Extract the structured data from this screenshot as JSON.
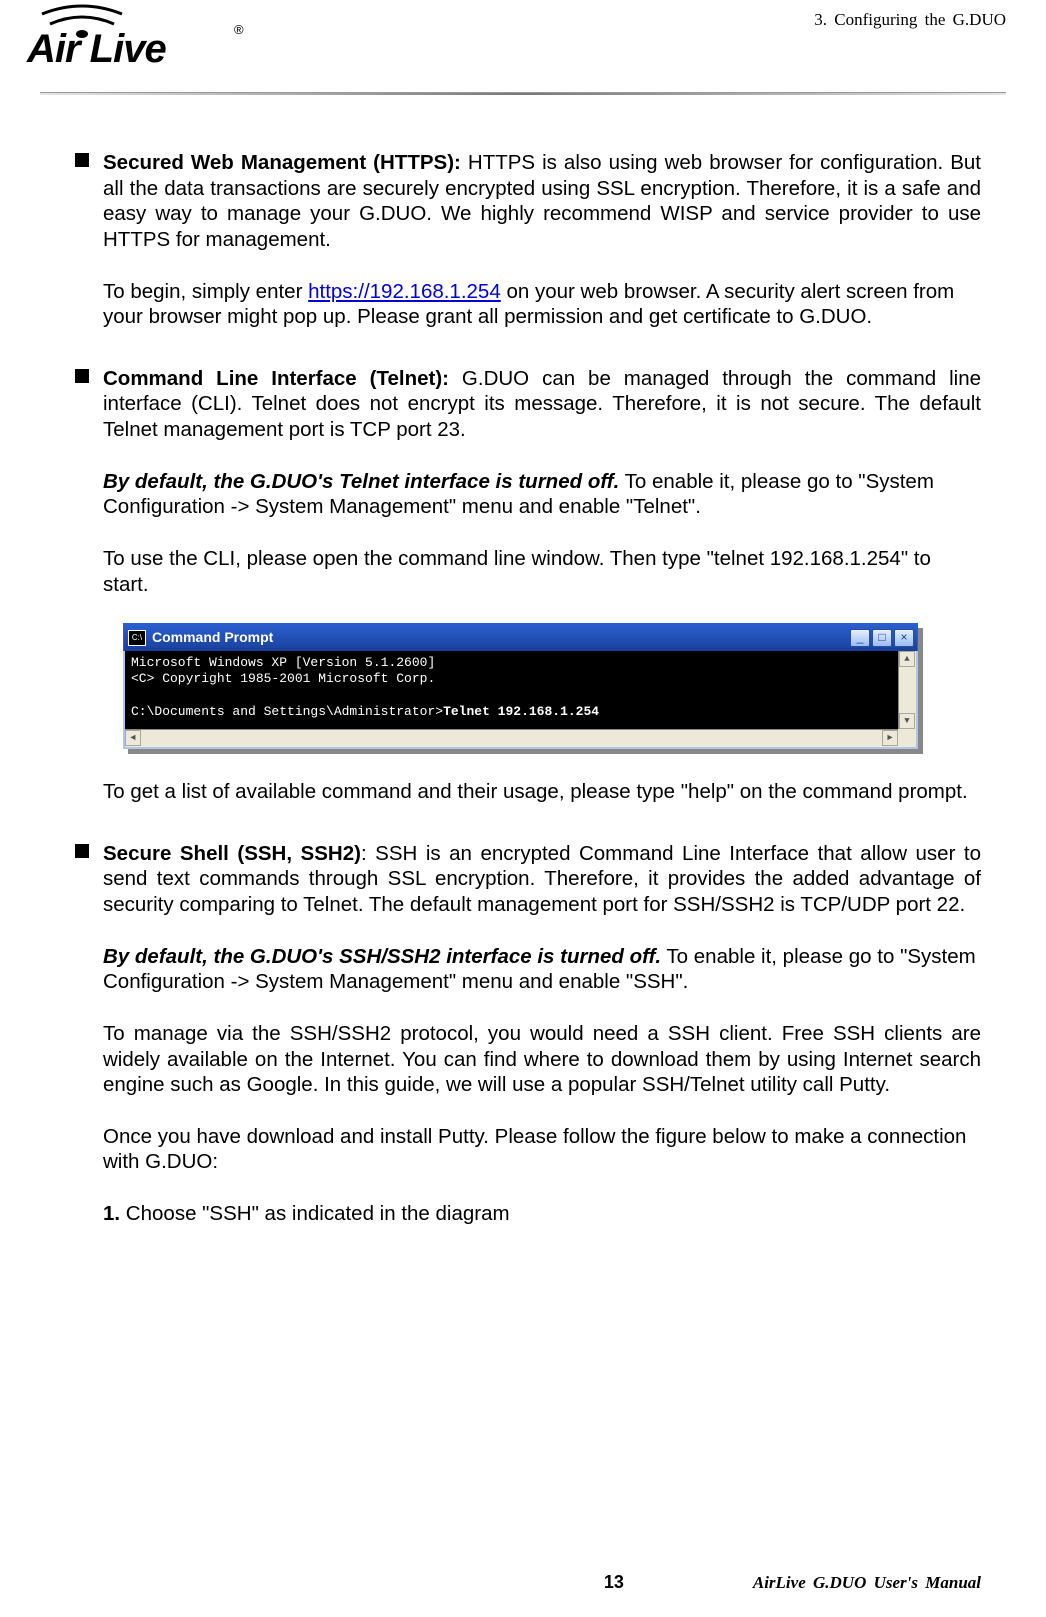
{
  "header": {
    "brand": "Air Live",
    "chapter": "3.  Configuring  the  G.DUO"
  },
  "body": {
    "https": {
      "title": "Secured  Web  Management  (HTTPS):",
      "para1_tail": "  HTTPS  is  also  using  web  browser  for configuration.     But  all  the  data  transactions  are  securely  encrypted  using  SSL encryption.    Therefore, it is a safe and easy way to manage your G.DUO.    We highly recommend WISP and service provider to use HTTPS for management.",
      "para2_pre": "To begin, simply enter ",
      "link": "https://192.168.1.254",
      "para2_post": " on your web browser.    A security alert screen from your browser might pop up.    Please grant all permission and get certificate to G.DUO."
    },
    "telnet": {
      "title": "Command  Line  Interface  (Telnet):",
      "para1_tail": "    G.DUO  can  be  managed  through  the command line interface (CLI).    Telnet does not encrypt its message.    Therefore, it is not secure.    The default Telnet management port is TCP port 23.",
      "para2_bold": "By default, the G.DUO's Telnet interface is turned off.",
      "para2_rest": "    To enable it, please go to \"System Configuration -> System Management\" menu and enable \"Telnet\".",
      "para3": "To use the CLI, please open the command line window.    Then type \"telnet 192.168.1.254\" to start.",
      "para4": "To get a list of available command and their usage, please type \"help\" on the command prompt."
    },
    "cmd": {
      "title": "Command Prompt",
      "line1": "Microsoft Windows XP [Version 5.1.2600]",
      "line2": "<C> Copyright 1985-2001 Microsoft Corp.",
      "line3_pre": "C:\\Documents and Settings\\Administrator>",
      "line3_cmd": "Telnet 192.168.1.254",
      "btn_min": "_",
      "btn_max": "□",
      "btn_close": "×",
      "icon_text": "C:\\"
    },
    "ssh": {
      "title": "Secure Shell  (SSH,  SSH2)",
      "para1_tail": ":    SSH  is  an  encrypted  Command  Line  Interface  that allow user to send text commands through SSL encryption.    Therefore, it provides the  added  advantage  of  security  comparing  to  Telnet.    The  default  management port for SSH/SSH2 is TCP/UDP port 22.",
      "para2_bold": "By default, the G.DUO's SSH/SSH2 interface is turned off.",
      "para2_rest": "    To enable it, please go to \"System Configuration -> System Management\" menu and enable \"SSH\".",
      "para3": "To manage via the SSH/SSH2 protocol, you would need a SSH client.    Free SSH clients are widely available on the Internet.    You can find where to download them by  using  Internet  search  engine  such  as  Google.    In  this  guide,  we  will  use  a popular SSH/Telnet utility call Putty.",
      "para4": "Once you have download and install Putty.    Please follow the figure below to make a connection with G.DUO:",
      "step1_no": "1.",
      "step1_text": " Choose \"SSH\" as indicated in the diagram"
    }
  },
  "footer": {
    "page": "13",
    "manual": "AirLive  G.DUO  User's  Manual"
  }
}
